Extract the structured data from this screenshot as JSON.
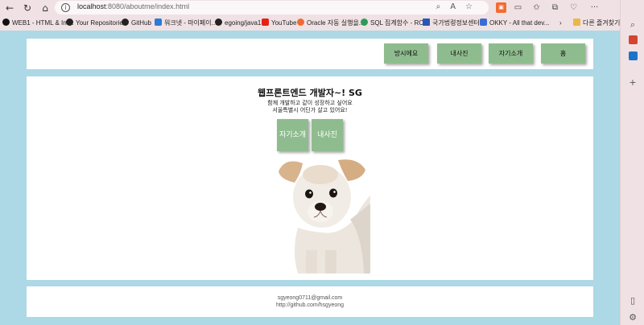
{
  "browser": {
    "url_host": "localhost",
    "url_path": ":8080/aboutme/index.html",
    "bookmarks": [
      {
        "label": "WEB1 - HTML & Int...",
        "icon": "black-circle-icon",
        "color": "#111111"
      },
      {
        "label": "Your Repositories",
        "icon": "github-icon",
        "color": "#222222"
      },
      {
        "label": "GitHub",
        "icon": "github-icon",
        "color": "#222222"
      },
      {
        "label": "워크넷 - 마이페이...",
        "icon": "worknet-icon",
        "color": "#2d7ad6"
      },
      {
        "label": "egoing/java1",
        "icon": "github-icon",
        "color": "#222222"
      },
      {
        "label": "YouTube",
        "icon": "youtube-icon",
        "color": "#e62117"
      },
      {
        "label": "Oracle 자동 실행을...",
        "icon": "oracle-icon",
        "color": "#f06a35"
      },
      {
        "label": "SQL 집계함수 - RO...",
        "icon": "sql-icon",
        "color": "#2d9a5a"
      },
      {
        "label": "국가법령정보센터",
        "icon": "law-icon",
        "color": "#2856b6"
      },
      {
        "label": "OKKY - All that dev...",
        "icon": "okky-icon",
        "color": "#3a6cd6"
      }
    ],
    "bookmarks_folder": "다른 즐겨찾기"
  },
  "header": {
    "nav_buttons": [
      "방시에요",
      "내사진",
      "자기소개",
      "홈"
    ]
  },
  "main": {
    "title": "웹프론트엔드 개발자~! SG",
    "desc_line1": "함께 개발하고 같이 성장하고 싶어요",
    "desc_line2": "서울특별시 어딘가 살고 있어요!",
    "buttons": [
      "자기소개",
      "내사진"
    ]
  },
  "footer": {
    "email": "sgyeong0711@gmail.com",
    "link": "http://github.com/hsgyeong"
  },
  "colors": {
    "page_bg": "#add8e6",
    "button_bg": "#8fbc8f"
  }
}
